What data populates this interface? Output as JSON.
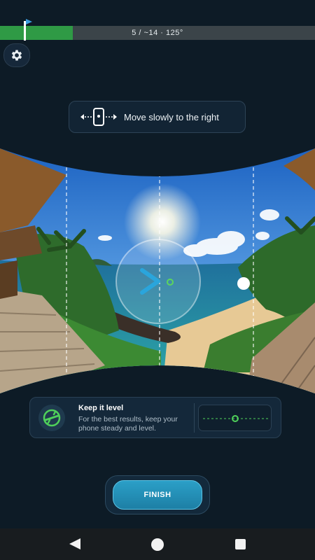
{
  "progress": {
    "text": "5 / ~14 · 125°",
    "fraction": 0.23
  },
  "toolbar": {
    "settings_icon": "gear-icon"
  },
  "hint": {
    "icon": "phone-move-arrows-icon",
    "text": "Move slowly to the right"
  },
  "capture": {
    "direction_icon": "chevron-right-icon",
    "target_icon": "target-dot-icon"
  },
  "tip": {
    "icon": "level-icon",
    "title": "Keep it level",
    "body": "For the best results, keep your phone steady and level."
  },
  "finish": {
    "label": "FINISH"
  },
  "navbar": {
    "back": "back-icon",
    "home": "home-icon",
    "recents": "recents-icon"
  },
  "colors": {
    "accent": "#2f9a45",
    "button": "#2b9fc7",
    "background": "#0d1b26"
  }
}
